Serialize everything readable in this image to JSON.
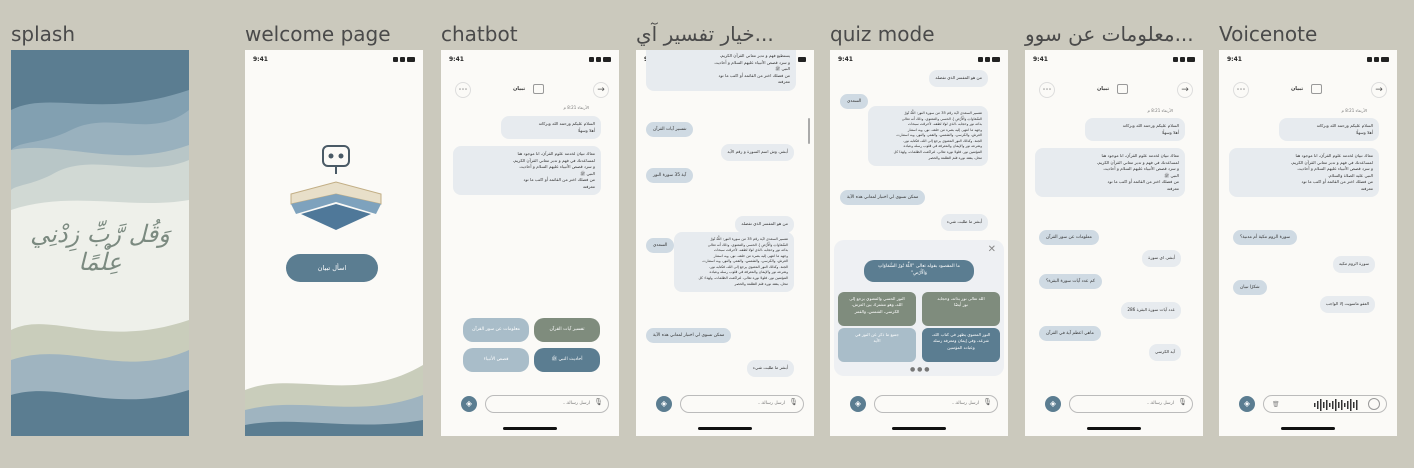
{
  "screens": [
    {
      "label": "splash"
    },
    {
      "label": "welcome page",
      "status_time": "9:41",
      "ask_button": "اسأل تبيان"
    },
    {
      "label": "chatbot"
    },
    {
      "label": "خيار تفسير آي..."
    },
    {
      "label": "quiz mode"
    },
    {
      "label": "معلومات عن سوو..."
    },
    {
      "label": "Voicenote"
    }
  ],
  "splash": {
    "calligraphy": "وَقُل رَّبِّ زِدْنِي عِلْمًا"
  },
  "common": {
    "status_time": "9:41",
    "bot_name": "تبيان",
    "input_placeholder": "ارسل رسالة...",
    "date_label": "الأربعاء 8:21 م",
    "greeting": "السلام عليكم ورحمة الله وبركاته\nأهلا وسهلًا",
    "intro": "معاك تبيان لخدمة علوم القرآن، انا موجود هنا\nلمساعدتك في فهم و تدبر معاني القرآن الكريم،\nو سرد قصص الأنبياء عليهم السلام و أحاديث\nالنبي ﷺ\nمن فضلك اختر من القائمة أو اكتب ما تود\nمعرفته"
  },
  "chatbot": {
    "chips": [
      "معلومات عن سور القرآن",
      "تفسير آيات القرآن",
      "قصص الأنبياء",
      "أحاديث النبي ﷺ"
    ]
  },
  "tafsir": {
    "top_bubble": "يستطيع فهم و تدبر معاني القرآن الكريم،\nو سرد قصص الأنبياء عليهم السلام و أحاديث\nالنبي ﷺ\nمن فضلك اختر من القائمة أو اكتب ما تود\nمعرفته",
    "user1": "تفسير آيات القرآن",
    "bot1": "أبشر، وش اسم السورة و رقم الآية",
    "user2": "آية 35 سورة النور",
    "bot2": "من هو المفسر الذي تفضله",
    "user3": "السعدي",
    "tafsir_text": "تفسير السعدي لآية رقم 35 من سورة النور: اللَّهُ نُورُ\nالسَّمَاوَاتِ وَالْأَرْضِ } الحسي والمعنوي، وذلك أنه تعالى\nبذاته نور وحجابه -الذي لولا لطفه، لأحرقت سبحات\nوجهه ما انتهى إليه بصره من خلقه- نور، وبه استنار\nالعرش، والكرسي، والشمس، والقمر، والنور، وبه استنارت\nالجنة. وكذلك النور المعنوي يرجع إلى الله، فكتابه نور،\nوشرعه نور والإيمان والمعرفة في قلوب رسله وعباده\nالمؤمنين نور. فلولا نوره تعالى، لتراكمت الظلمات، ولهذا: كل\nمحل، يفقد نوره فثم الظلمة والحصر",
    "user4": "ممكن تسوي لي اختبار لمعاني هذه الآية",
    "bot4": "أبشر ما طلبت شيء"
  },
  "quiz": {
    "bot_top": "من هو المفسر الذي تفضله",
    "user": "السعدي",
    "tafsir_text": "تفسير السعدي لآية رقم 35 من سورة النور: اللَّهُ نُورُ\nالسَّمَاوَاتِ وَالْأَرْضِ } الحسي والمعنوي، وذلك أنه تعالى\nبذاته نور وحجابه -الذي لولا لطفه، لأحرقت سبحات\nوجهه ما انتهى إليه بصره من خلقه- نور، وبه استنار\nالعرش، والكرسي، والشمس، والقمر، والنور، وبه استنارت\nالجنة. وكذلك النور المعنوي يرجع إلى الله، فكتابه نور،\nوشرعه نور والإيمان والمعرفة في قلوب رسله وعباده\nالمؤمنين نور. فلولا نوره تعالى، لتراكمت الظلمات، ولهذا كل\nمحل، يفقد نوره فثم الظلمة والحصر",
    "user2": "ممكن تسوي لي اختبار لمعاني هذه الآية",
    "bot2": "أبشر ما طلبت شيء",
    "question": "ما المقصود بقوله تعالى \"اللَّهُ نُورُ السَّمَاوَاتِ\nوَالْأَرْضِ\"",
    "answers": [
      "الله تعالى نور بذاته، وحجابه\nنور أيضًا",
      "النور الحسي والمعنوي يرجع إلى\nالله، وهو مشترك بين العرش،\nالكرسي، الشمس، والقمر",
      "النور المعنوي يظهر في كتاب الله،\nشرعه، وفي إيمان ومعرفة رسله\nوعباده المؤمنين",
      "جميع ما ذكر عن النور في\nالآية"
    ]
  },
  "surah": {
    "user1": "معلومات عن سور القرآن",
    "bot1": "أبشر، اي سورة",
    "user2": "كم عدد آيات سورة البقرة؟",
    "bot2": "عدد آيات سورة البقرة 286",
    "user3": "ماهي اعظم آية في القرآن",
    "bot3": "آية الكرسي"
  },
  "voice": {
    "intro": "معاك تبيان لخدمة علوم القرآن، انا موجود هنا\nلمساعدتك في فهم و تدبر معاني القرآن الكريم،\nو سرد قصص الأنبياء عليهم السلام و أحاديث\nالنبي عليه الصلاة والسلام.\nمن فضلك اختر من القائمة أو اكتب ما تود\nمعرفته",
    "user1": "سورة الروم مكية أم مدنية؟",
    "bot1": "سورة الروم مكية",
    "user2": "شكرًا تبيان",
    "bot2": "العفو ماسويت إلا الواجب"
  },
  "colors": {
    "dark_teal": "#5b7d91",
    "sage": "#7f8c7d",
    "light_blue": "#a9bdc9",
    "bubble_user": "#cfdae3",
    "bubble_bot": "#e7ebef"
  }
}
